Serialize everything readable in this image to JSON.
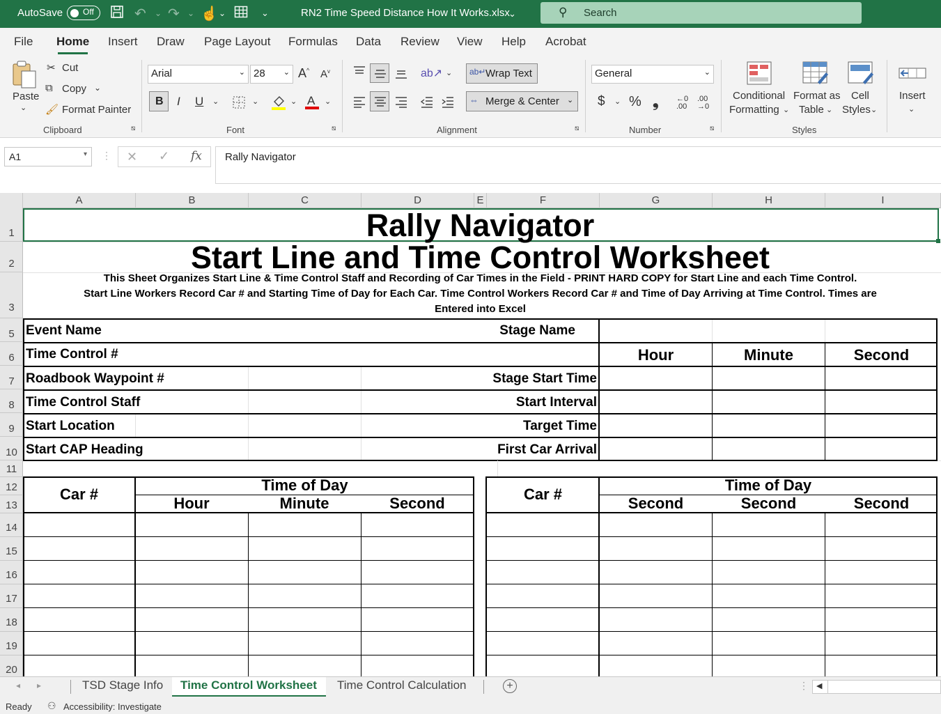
{
  "titlebar": {
    "autosave_label": "AutoSave",
    "autosave_state": "Off",
    "filename": "RN2 Time Speed Distance How It Works.xlsx",
    "search_placeholder": "Search"
  },
  "menu_tabs": [
    "File",
    "Home",
    "Insert",
    "Draw",
    "Page Layout",
    "Formulas",
    "Data",
    "Review",
    "View",
    "Help",
    "Acrobat"
  ],
  "active_tab": "Home",
  "ribbon": {
    "clipboard": {
      "paste": "Paste",
      "cut": "Cut",
      "copy": "Copy",
      "format_painter": "Format Painter",
      "group": "Clipboard"
    },
    "font": {
      "name": "Arial",
      "size": "28",
      "bold": "B",
      "italic": "I",
      "underline": "U",
      "group": "Font"
    },
    "alignment": {
      "wrap_text": "Wrap Text",
      "merge_center": "Merge & Center",
      "group": "Alignment"
    },
    "number": {
      "format": "General",
      "currency": "$",
      "percent": "%",
      "comma": "❟",
      "group": "Number"
    },
    "styles": {
      "conditional": "Conditional",
      "conditional2": "Formatting",
      "format_table": "Format as",
      "format_table2": "Table",
      "cell_styles": "Cell",
      "cell_styles2": "Styles",
      "group": "Styles"
    },
    "cells": {
      "insert": "Insert"
    }
  },
  "formula_bar": {
    "name_box": "A1",
    "fx": "fx",
    "content": "Rally Navigator"
  },
  "columns": [
    "A",
    "B",
    "C",
    "D",
    "E",
    "F",
    "G",
    "H",
    "I"
  ],
  "rows": [
    "1",
    "2",
    "3",
    "5",
    "6",
    "7",
    "8",
    "9",
    "10",
    "11",
    "12",
    "13",
    "14",
    "15",
    "16",
    "17",
    "18",
    "19",
    "20"
  ],
  "sheet": {
    "title": "Rally Navigator",
    "subtitle": "Start Line and Time Control Worksheet",
    "desc1": "This Sheet Organizes Start Line & Time Control Staff and Recording of Car Times in the Field - PRINT HARD COPY for Start Line and each Time Control.",
    "desc2": "Start Line Workers Record Car # and Starting Time of Day for Each Car. Time Control Workers Record Car # and Time of Day Arriving at Time Control. Times are",
    "desc3": "Entered into Excel",
    "event_name": "Event Name",
    "stage_name": "Stage Name",
    "time_control": "Time Control #",
    "hour": "Hour",
    "minute": "Minute",
    "second": "Second",
    "roadbook": "Roadbook Waypoint #",
    "stage_start": "Stage Start Time",
    "tc_staff": "Time Control Staff",
    "start_interval": "Start Interval",
    "start_location": "Start Location",
    "target_time": "Target Time",
    "cap_heading": "Start CAP Heading",
    "first_arrival": "First Car Arrival",
    "left_table": {
      "car": "Car #",
      "tod": "Time of Day",
      "h": "Hour",
      "m": "Minute",
      "s": "Second"
    },
    "right_table": {
      "car": "Car #",
      "tod": "Time of Day",
      "h": "Second",
      "m": "Second",
      "s": "Second"
    }
  },
  "sheet_tabs": [
    "TSD Stage Info",
    "Time Control Worksheet",
    "Time Control Calculation"
  ],
  "active_sheet": "Time Control Worksheet",
  "status": {
    "ready": "Ready",
    "accessibility": "Accessibility: Investigate"
  },
  "colors": {
    "excel_green": "#217346",
    "search_bg": "#a7d3b9"
  }
}
